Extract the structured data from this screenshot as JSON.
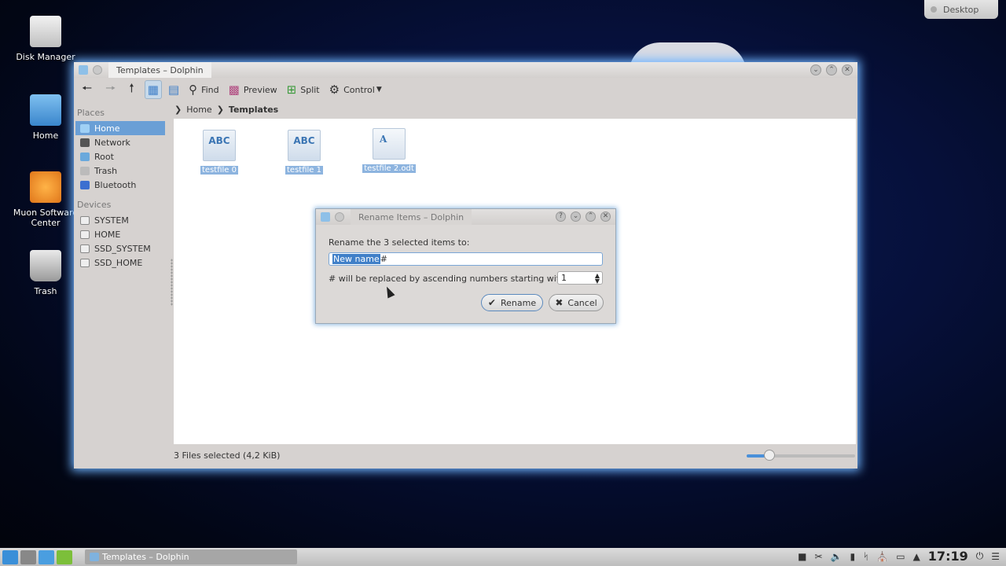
{
  "desktop": {
    "button_label": "Desktop",
    "icons": [
      {
        "label": "Disk Manager"
      },
      {
        "label": "Home"
      },
      {
        "label": "Muon Software Center"
      },
      {
        "label": "Trash"
      }
    ]
  },
  "window": {
    "title": "Templates – Dolphin",
    "toolbar": {
      "find": "Find",
      "preview": "Preview",
      "split": "Split",
      "control": "Control"
    },
    "breadcrumb": {
      "home": "Home",
      "current": "Templates"
    },
    "sidebar": {
      "places_title": "Places",
      "places": [
        "Home",
        "Network",
        "Root",
        "Trash",
        "Bluetooth"
      ],
      "devices_title": "Devices",
      "devices": [
        "SYSTEM",
        "HOME",
        "SSD_SYSTEM",
        "SSD_HOME"
      ]
    },
    "files": [
      {
        "name": "testfile 0",
        "icon_text": "ABC"
      },
      {
        "name": "testfile 1",
        "icon_text": "ABC"
      },
      {
        "name": "testfile 2.odt",
        "icon_text": "A"
      }
    ],
    "status": "3 Files selected (4,2 KiB)",
    "zoom_level": 0.2
  },
  "dialog": {
    "title": "Rename Items – Dolphin",
    "label": "Rename the 3 selected items to:",
    "input_selected": "New name ",
    "input_rest": "#",
    "number_label": "# will be replaced by ascending numbers starting with:",
    "start_number": "1",
    "rename_label": "Rename",
    "cancel_label": "Cancel"
  },
  "taskbar": {
    "task": "Templates – Dolphin",
    "clock": "17:19"
  },
  "colors": {
    "accent": "#6a9fd6",
    "selection": "#3f7fc8",
    "glow": "#6fb4ff"
  }
}
